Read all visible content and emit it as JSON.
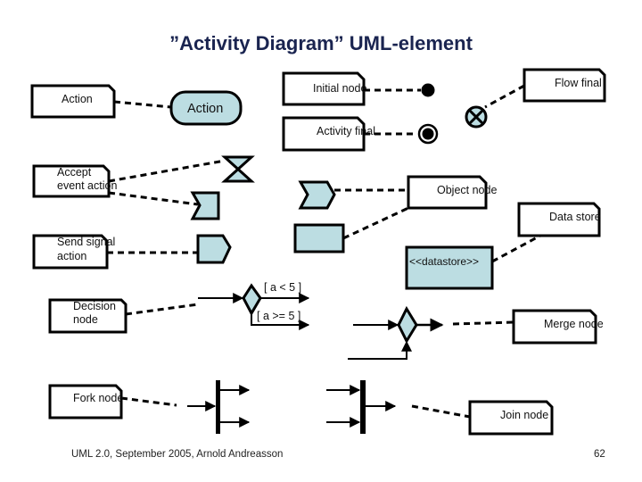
{
  "slide": {
    "title": "”Activity Diagram” UML-element",
    "footer_left": "UML 2.0, September 2005, Arnold Andreasson",
    "page_number": "62"
  },
  "colors": {
    "shape_fill": "#bcdde2",
    "stroke": "#000000",
    "title": "#1a2450"
  },
  "notes": {
    "action": "Action",
    "initial_node": "Initial node",
    "flow_final": "Flow final",
    "activity_final": "Activity final",
    "accept_event_line1": "Accept",
    "accept_event_line2": "event action",
    "object_node": "Object node",
    "data_store": "Data store",
    "send_signal_line1": "Send signal",
    "send_signal_line2": "action",
    "decision_line1": "Decision",
    "decision_line2": "node",
    "merge_node": "Merge node",
    "fork_node": "Fork node",
    "join_node": "Join node"
  },
  "shapes": {
    "action_label": "Action",
    "datastore_label": "<<datastore>>",
    "guard_1": "[ a < 5 ]",
    "guard_2": "[ a >= 5 ]"
  }
}
